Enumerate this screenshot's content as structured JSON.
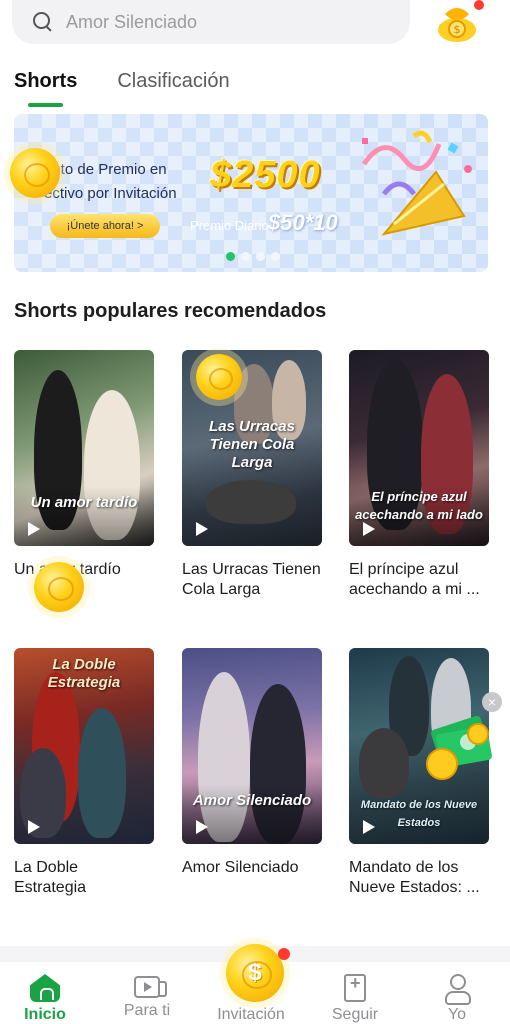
{
  "search": {
    "placeholder": "Amor Silenciado"
  },
  "tabs": [
    {
      "label": "Shorts",
      "active": true
    },
    {
      "label": "Clasificación",
      "active": false
    }
  ],
  "banner": {
    "line1": "ento de Premio en",
    "line2": "ectivo por Invitación",
    "join_label": "¡Únete ahora! >",
    "amount": "$2500",
    "daily_label": "Premio Diario",
    "daily_value": "$50*10",
    "slide_count": 4,
    "active_slide": 1
  },
  "section_title": "Shorts populares recomendados",
  "shorts": [
    {
      "title": "Un amor tardío",
      "poster_text": "Un amor tardío"
    },
    {
      "title": "Las Urracas Tienen Cola Larga",
      "poster_text": "Las Urracas Tienen Cola Larga"
    },
    {
      "title": "El príncipe azul acechando a mi ...",
      "poster_text": "El príncipe azul acechando a mi lado"
    },
    {
      "title": "La Doble Estrategia",
      "poster_text": "La Doble Estrategia"
    },
    {
      "title": "Amor Silenciado",
      "poster_text": "Amor Silenciado"
    },
    {
      "title": "Mandato de los Nueve Estados: ...",
      "poster_text": "Mandato de los Nueve Estados"
    }
  ],
  "nav": [
    {
      "label": "Inicio",
      "icon": "home-icon",
      "active": true
    },
    {
      "label": "Para ti",
      "icon": "video-icon",
      "active": false
    },
    {
      "label": "Invitación",
      "icon": "coin-icon",
      "active": false
    },
    {
      "label": "Seguir",
      "icon": "bookmark-add-icon",
      "active": false
    },
    {
      "label": "Yo",
      "icon": "user-icon",
      "active": false
    }
  ],
  "colors": {
    "accent": "#1aa345",
    "coin": "#ffd21a",
    "badge": "#ff3b30"
  }
}
